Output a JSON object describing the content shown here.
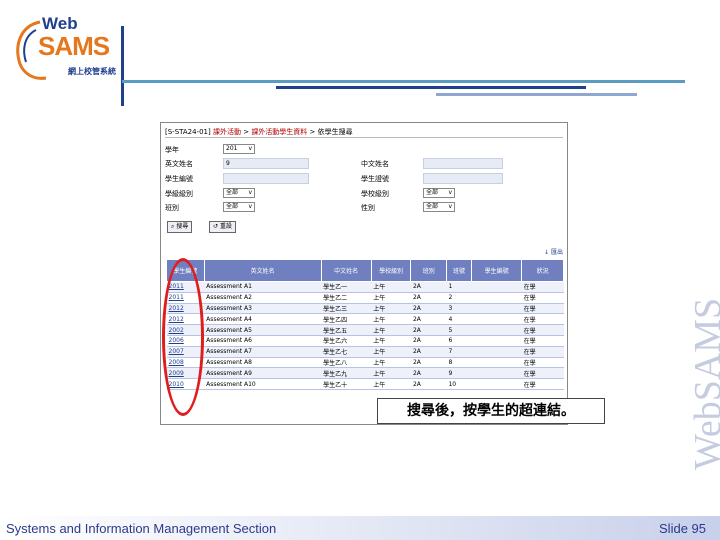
{
  "logo": {
    "web": "Web",
    "sams": "SAMS",
    "sub": "網上校管系統"
  },
  "watermark": "WebSAMS",
  "footer": {
    "section": "Systems and Information Management Section",
    "slide": "Slide 95"
  },
  "colors": {
    "navy": "#1f3f8f",
    "orange": "#e5771c",
    "teal": "#5a9bc2",
    "header": "#6f7fbf",
    "red": "#e01d1d"
  },
  "screen": {
    "breadcrumb": {
      "prefix": "[S-STA24-01]",
      "link1": "課外活動",
      "link2": "課外活動學生資料",
      "current": "依學生搜尋"
    },
    "form": {
      "school_year": {
        "label": "學年",
        "value": "201"
      },
      "eng_name": {
        "label": "英文姓名",
        "value": "9"
      },
      "chi_name": {
        "label": "中文姓名",
        "value": ""
      },
      "reg_no": {
        "label": "學生編號",
        "value": ""
      },
      "student_id": {
        "label": "學生證號",
        "value": ""
      },
      "class_level": {
        "label": "學級級別",
        "value": "全部"
      },
      "school_level": {
        "label": "學校級別",
        "value": "全部"
      },
      "class": {
        "label": "班別",
        "value": "全部"
      },
      "gender": {
        "label": "性別",
        "value": "全部"
      }
    },
    "buttons": {
      "search": "搜尋",
      "reset": "重設"
    },
    "export": "匯出",
    "table": {
      "headers": [
        "學生編號",
        "英文姓名",
        "中文姓名",
        "學校級別",
        "班別",
        "班號",
        "學生編號",
        "狀況"
      ],
      "rows": [
        [
          "2011",
          "Assessment A1",
          "學生乙一",
          "上午",
          "2A",
          "1",
          "",
          "在學"
        ],
        [
          "2011",
          "Assessment A2",
          "學生乙二",
          "上午",
          "2A",
          "2",
          "",
          "在學"
        ],
        [
          "2012",
          "Assessment A3",
          "學生乙三",
          "上午",
          "2A",
          "3",
          "",
          "在學"
        ],
        [
          "2012",
          "Assessment A4",
          "學生乙四",
          "上午",
          "2A",
          "4",
          "",
          "在學"
        ],
        [
          "2002",
          "Assessment A5",
          "學生乙五",
          "上午",
          "2A",
          "5",
          "",
          "在學"
        ],
        [
          "2006",
          "Assessment A6",
          "學生乙六",
          "上午",
          "2A",
          "6",
          "",
          "在學"
        ],
        [
          "2007",
          "Assessment A7",
          "學生乙七",
          "上午",
          "2A",
          "7",
          "",
          "在學"
        ],
        [
          "2008",
          "Assessment A8",
          "學生乙八",
          "上午",
          "2A",
          "8",
          "",
          "在學"
        ],
        [
          "2009",
          "Assessment A9",
          "學生乙九",
          "上午",
          "2A",
          "9",
          "",
          "在學"
        ],
        [
          "2010",
          "Assessment A10",
          "學生乙十",
          "上午",
          "2A",
          "10",
          "",
          "在學"
        ]
      ]
    }
  },
  "callout": "搜尋後，按學生的超連結。"
}
